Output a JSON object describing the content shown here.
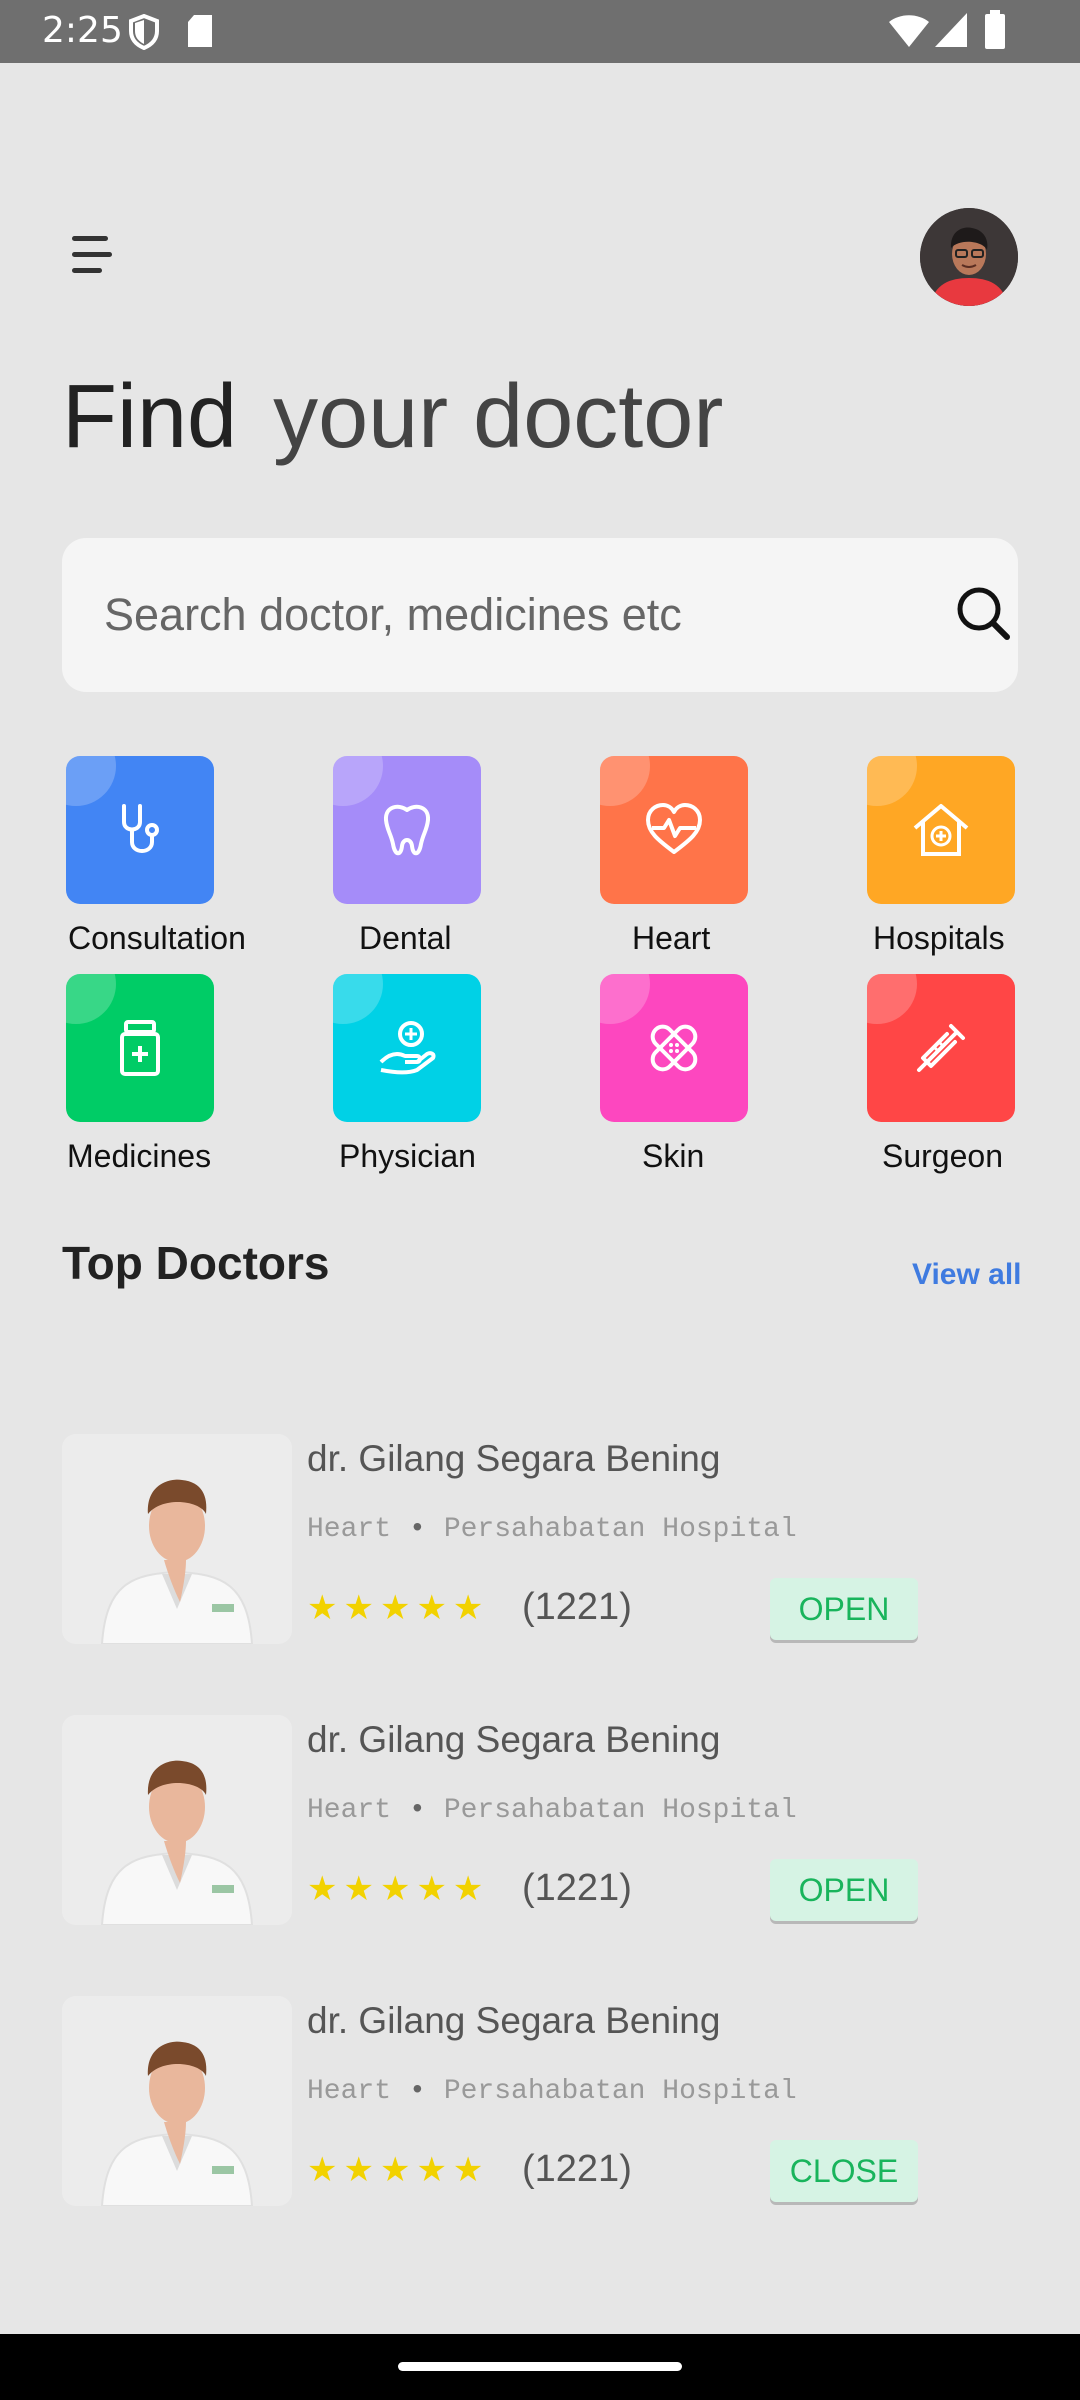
{
  "status_bar": {
    "time": "2:25"
  },
  "header": {
    "title_first": "Find",
    "title_rest": "your doctor"
  },
  "search": {
    "placeholder": "Search doctor, medicines etc"
  },
  "categories": [
    {
      "label": "Consultation",
      "icon": "stethoscope-icon",
      "color": "#4285f4"
    },
    {
      "label": "Dental",
      "icon": "tooth-icon",
      "color": "#a58cf9"
    },
    {
      "label": "Heart",
      "icon": "heart-pulse-icon",
      "color": "#ff7449"
    },
    {
      "label": "Hospitals",
      "icon": "hospital-house-icon",
      "color": "#ffa724"
    },
    {
      "label": "Medicines",
      "icon": "medicine-bottle-icon",
      "color": "#00cc66"
    },
    {
      "label": "Physician",
      "icon": "hand-care-icon",
      "color": "#00d1e6"
    },
    {
      "label": "Skin",
      "icon": "bandage-icon",
      "color": "#fd47bf"
    },
    {
      "label": "Surgeon",
      "icon": "syringe-icon",
      "color": "#ff4646"
    }
  ],
  "top_doctors": {
    "title": "Top Doctors",
    "view_all": "View all",
    "items": [
      {
        "name": "dr. Gilang Segara Bening",
        "specialty": "Heart",
        "hospital": "Persahabatan Hospital",
        "stars": "★★★★★",
        "reviews": "(1221)",
        "status": "OPEN"
      },
      {
        "name": "dr. Gilang Segara Bening",
        "specialty": "Heart",
        "hospital": "Persahabatan Hospital",
        "stars": "★★★★★",
        "reviews": "(1221)",
        "status": "OPEN"
      },
      {
        "name": "dr. Gilang Segara Bening",
        "specialty": "Heart",
        "hospital": "Persahabatan Hospital",
        "stars": "★★★★★",
        "reviews": "(1221)",
        "status": "CLOSE"
      }
    ]
  },
  "colors": {
    "accent": "#3f7be0",
    "badge_bg": "#d6f3e4",
    "badge_text": "#19b45c",
    "star": "#f2d200"
  }
}
